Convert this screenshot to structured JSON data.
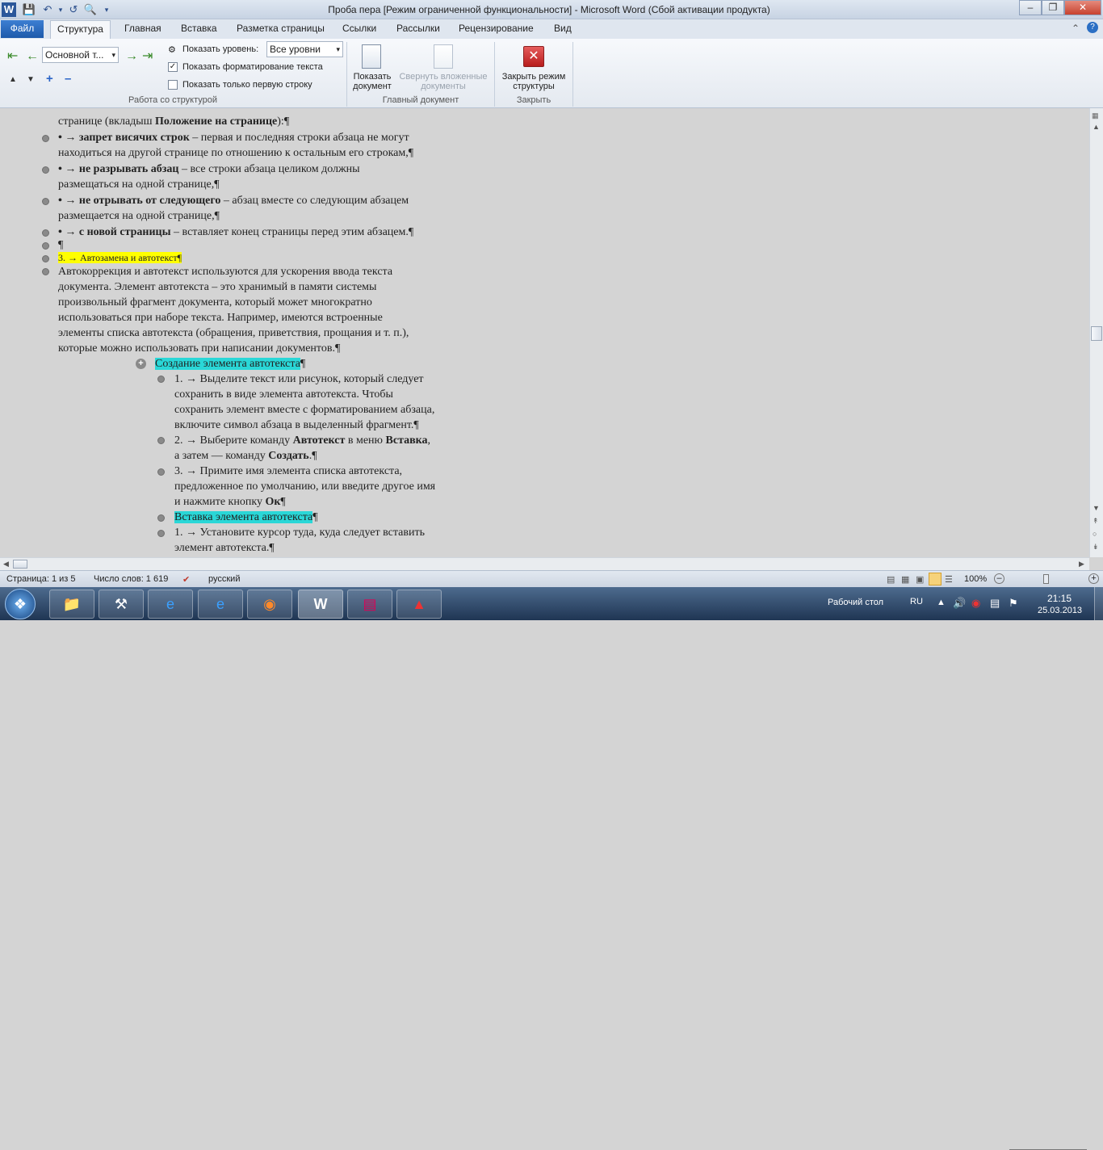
{
  "titlebar": {
    "title": "Проба пера [Режим ограниченной функциональности]  -  Microsoft Word (Сбой активации продукта)",
    "app_icon": "W"
  },
  "tabs": {
    "file": "Файл",
    "active": "Структура",
    "others": [
      "Главная",
      "Вставка",
      "Разметка страницы",
      "Ссылки",
      "Рассылки",
      "Рецензирование",
      "Вид"
    ]
  },
  "ribbon": {
    "level_dropdown": "Основной т...",
    "show_level_label": "Показать уровень:",
    "show_level_value": "Все уровни",
    "show_formatting": "Показать форматирование текста",
    "show_first_line": "Показать только первую строку",
    "group_outline": "Работа со структурой",
    "show_document": [
      "Показать",
      "документ"
    ],
    "collapse_subdocs": [
      "Свернуть вложенные",
      "документы"
    ],
    "group_master": "Главный документ",
    "close_outline": [
      "Закрыть режим",
      "структуры"
    ],
    "group_close": "Закрыть"
  },
  "doc": {
    "l1": "странице (вкладыш ",
    "l1b": "Положение на странице",
    "l1c": "):¶",
    "l2a": "•  →   ",
    "l2b": "запрет висячих строк",
    "l2c": " – первая и последняя строки абзаца не могут",
    "l3": "находиться на другой странице по отношению к остальным его строкам,¶",
    "l4a": "•  →   ",
    "l4b": "не разрывать абзац",
    "l4c": " – все строки абзаца целиком должны",
    "l5": "размещаться на одной странице,¶",
    "l6a": "•  →   ",
    "l6b": "не отрывать от следующего",
    "l6c": " – абзац вместе со следующим абзацем",
    "l7": "размещается на одной странице,¶",
    "l8a": "•  →   ",
    "l8b": "с новой страницы",
    "l8c": " – вставляет конец страницы перед этим абзацем.¶",
    "l9": "¶",
    "l10": "3.   →   Автозамена и автотекст¶",
    "p1": "Автокоррекция и автотекст используются для ускорения ввода текста",
    "p2": "документа. Элемент автотекста – это хранимый в памяти системы",
    "p3": "произвольный фрагмент документа, который может многократно",
    "p4": "использоваться при наборе текста. Например, имеются встроенные",
    "p5": "элементы списка автотекста (обращения, приветствия, прощания и т. п.),",
    "p6": "которые можно использовать при написании документов.¶",
    "h1": "Создание элемента автотекста",
    "pil": "¶",
    "s1a": "1.   →   Выделите текст или рисунок, который следует",
    "s1b": "сохранить в виде элемента автотекста. Чтобы",
    "s1c": "сохранить элемент вместе с форматированием абзаца,",
    "s1d": "включите символ абзаца в выделенный фрагмент.¶",
    "s2a": "2.   →   Выберите команду ",
    "s2b": "Автотекст",
    "s2c": " в меню ",
    "s2d": "Вставка",
    "s2e": ",",
    "s2f": "а затем — команду ",
    "s2g": "Создать",
    "s2h": ".¶",
    "s3a": "3.   →   Примите имя элемента списка автотекста,",
    "s3b": "предложенное по умолчанию, или введите другое имя",
    "s3c": "и нажмите кнопку ",
    "s3d": "Ок",
    "s3e": "¶",
    "h2": "Вставка элемента автотекста",
    "t1a": "1.   →   Установите курсор туда, куда следует вставить",
    "t1b": "элемент автотекста.¶"
  },
  "status": {
    "page": "Страница: 1 из 5",
    "words": "Число слов: 1 619",
    "lang": "русский",
    "zoom": "100%"
  },
  "taskbar": {
    "desktop": "Рабочий стол",
    "lang": "RU",
    "time": "21:15",
    "date": "25.03.2013"
  },
  "colors": {
    "accent": "#2b579a",
    "highlight_yellow": "#ffff00",
    "highlight_cyan": "#2ad7d7"
  }
}
